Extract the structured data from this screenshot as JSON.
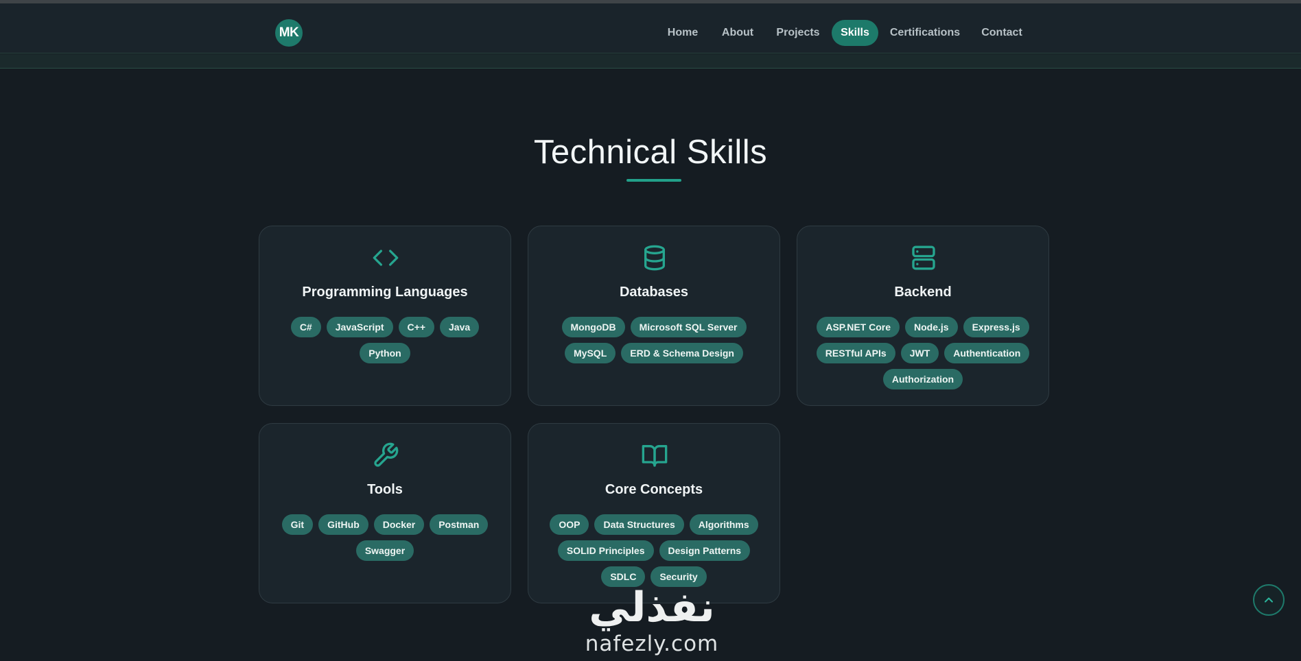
{
  "logo": {
    "text": "MK"
  },
  "nav": {
    "items": [
      {
        "label": "Home",
        "active": false
      },
      {
        "label": "About",
        "active": false
      },
      {
        "label": "Projects",
        "active": false
      },
      {
        "label": "Skills",
        "active": true
      },
      {
        "label": "Certifications",
        "active": false
      },
      {
        "label": "Contact",
        "active": false
      }
    ]
  },
  "section": {
    "title": "Technical Skills"
  },
  "cards": [
    {
      "title": "Programming Languages",
      "icon": "code-icon",
      "tags": [
        "C#",
        "JavaScript",
        "C++",
        "Java",
        "Python"
      ]
    },
    {
      "title": "Databases",
      "icon": "database-icon",
      "tags": [
        "MongoDB",
        "Microsoft SQL Server",
        "MySQL",
        "ERD & Schema Design"
      ]
    },
    {
      "title": "Backend",
      "icon": "server-icon",
      "tags": [
        "ASP.NET Core",
        "Node.js",
        "Express.js",
        "RESTful APIs",
        "JWT",
        "Authentication",
        "Authorization"
      ]
    },
    {
      "title": "Tools",
      "icon": "wrench-icon",
      "tags": [
        "Git",
        "GitHub",
        "Docker",
        "Postman",
        "Swagger"
      ]
    },
    {
      "title": "Core Concepts",
      "icon": "book-open-icon",
      "tags": [
        "OOP",
        "Data Structures",
        "Algorithms",
        "SOLID Principles",
        "Design Patterns",
        "SDLC",
        "Security"
      ]
    }
  ],
  "watermark": {
    "arabic": "نفذلي",
    "latin": "nafezly.com"
  },
  "colors": {
    "accent": "#1e7a6b",
    "tag_bg": "#2a6b64",
    "background": "#151c22",
    "card_bg": "#1b252c"
  }
}
